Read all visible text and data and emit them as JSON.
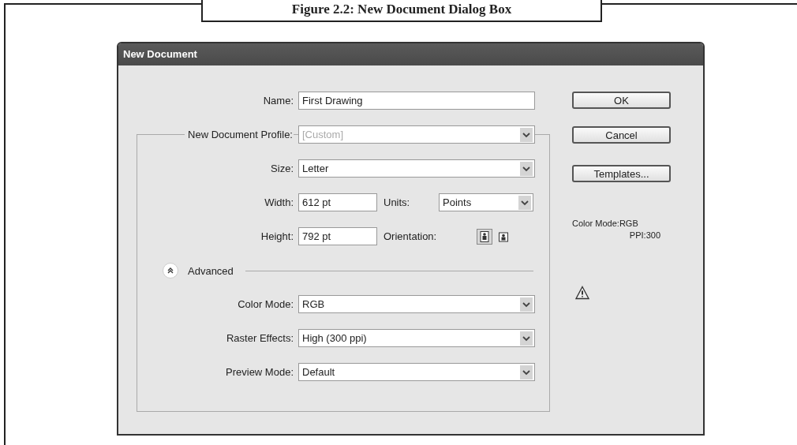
{
  "caption": "Figure 2.2: New Document Dialog Box",
  "window": {
    "title": "New Document"
  },
  "name": {
    "label": "Name:",
    "value": "First Drawing"
  },
  "profile": {
    "label": "New Document Profile:",
    "value": "[Custom]",
    "disabled": true
  },
  "size": {
    "label": "Size:",
    "value": "Letter"
  },
  "width": {
    "label": "Width:",
    "value": "612 pt"
  },
  "units": {
    "label": "Units:",
    "value": "Points"
  },
  "height": {
    "label": "Height:",
    "value": "792 pt"
  },
  "orientation": {
    "label": "Orientation:",
    "options": [
      {
        "kind": "portrait",
        "selected": true
      },
      {
        "kind": "landscape",
        "selected": false
      }
    ]
  },
  "advanced": {
    "label": "Advanced",
    "expanded": true
  },
  "advanced_fields": [
    {
      "label": "Color Mode:",
      "value": "RGB"
    },
    {
      "label": "Raster Effects:",
      "value": "High (300 ppi)"
    },
    {
      "label": "Preview Mode:",
      "value": "Default"
    }
  ],
  "buttons": [
    "OK",
    "Cancel",
    "Templates..."
  ],
  "info": [
    "Color Mode:RGB",
    "PPI:300"
  ]
}
